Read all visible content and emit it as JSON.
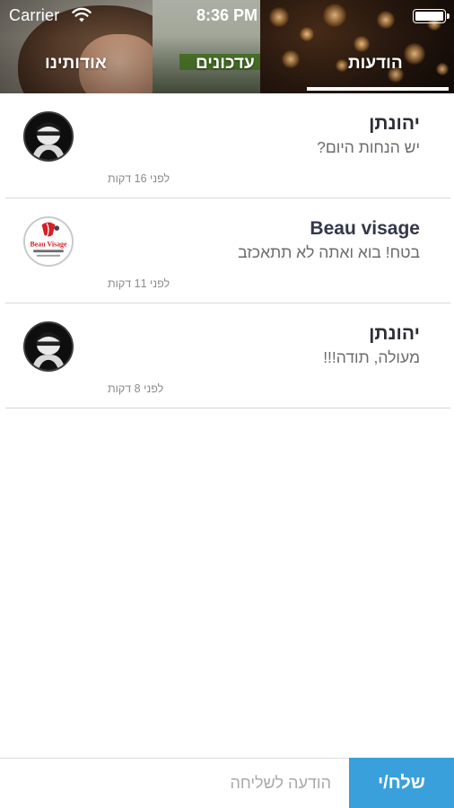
{
  "status_bar": {
    "carrier": "Carrier",
    "time": "8:36 PM",
    "icons": [
      "wifi-icon",
      "battery-icon"
    ]
  },
  "tabs": {
    "about": "אודותינו",
    "updates": "עדכונים",
    "messages": "הודעות",
    "selected": "messages"
  },
  "messages": [
    {
      "sender": "יהונתן",
      "preview": "יש הנחות היום?",
      "time_ago": "לפני 16 דקות",
      "avatar": "person-avatar"
    },
    {
      "sender": "Beau visage",
      "preview": "בטח! בוא ואתה לא תתאכזב",
      "time_ago": "לפני 11 דקות",
      "avatar": "beau-visage-logo",
      "logo_text": {
        "brand": "Beau Visage"
      }
    },
    {
      "sender": "יהונתן",
      "preview": "מעולה, תודה!!!",
      "time_ago": "לפני 8 דקות",
      "avatar": "person-avatar"
    }
  ],
  "compose": {
    "placeholder": "הודעה לשליחה",
    "value": "",
    "send_label": "שלח/י"
  },
  "colors": {
    "accent": "#3aa0dc",
    "divider": "#d8d8d8",
    "sender_text": "#2d2d35",
    "preview_text": "#6b6b6b"
  }
}
